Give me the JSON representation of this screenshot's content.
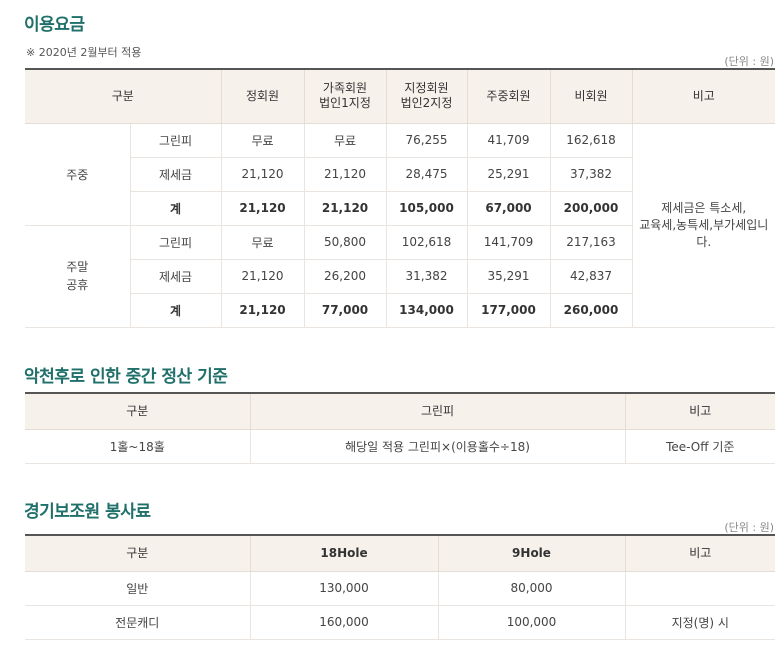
{
  "fees": {
    "title": "이용요금",
    "note": "※ 2020년 2월부터 적용",
    "unit": "(단위 : 원)",
    "headers": {
      "category": "구분",
      "regular": "정회원",
      "family": [
        "가족회원",
        "법인1지정"
      ],
      "designated": [
        "지정회원",
        "법인2지정"
      ],
      "weekday_member": "주중회원",
      "nonmember": "비회원",
      "remark": "비고"
    },
    "groups": [
      {
        "label": [
          "주중"
        ],
        "rows": [
          {
            "type": "그린피",
            "values": [
              "무료",
              "무료",
              "76,255",
              "41,709",
              "162,618"
            ]
          },
          {
            "type": "제세금",
            "values": [
              "21,120",
              "21,120",
              "28,475",
              "25,291",
              "37,382"
            ]
          },
          {
            "type": "계",
            "values": [
              "21,120",
              "21,120",
              "105,000",
              "67,000",
              "200,000"
            ]
          }
        ]
      },
      {
        "label": [
          "주말",
          "공휴"
        ],
        "rows": [
          {
            "type": "그린피",
            "values": [
              "무료",
              "50,800",
              "102,618",
              "141,709",
              "217,163"
            ]
          },
          {
            "type": "제세금",
            "values": [
              "21,120",
              "26,200",
              "31,382",
              "35,291",
              "42,837"
            ]
          },
          {
            "type": "계",
            "values": [
              "21,120",
              "77,000",
              "134,000",
              "177,000",
              "260,000"
            ]
          }
        ]
      }
    ],
    "remark_text": [
      "제세금은 특소세,",
      "교육세,농특세,부가세입니",
      "다."
    ]
  },
  "rain": {
    "title": "악천후로 인한 중간 정산 기준",
    "headers": [
      "구분",
      "그린피",
      "비고"
    ],
    "rows": [
      [
        "1홀~18홀",
        "해당일 적용 그린피×(이용홀수÷18)",
        "Tee-Off 기준"
      ]
    ]
  },
  "caddie": {
    "title": "경기보조원 봉사료",
    "unit": "(단위 : 원)",
    "headers": [
      "구분",
      "18Hole",
      "9Hole",
      "비고"
    ],
    "rows": [
      [
        "일반",
        "130,000",
        "80,000",
        ""
      ],
      [
        "전문캐디",
        "160,000",
        "100,000",
        "지정(명) 시"
      ]
    ]
  }
}
